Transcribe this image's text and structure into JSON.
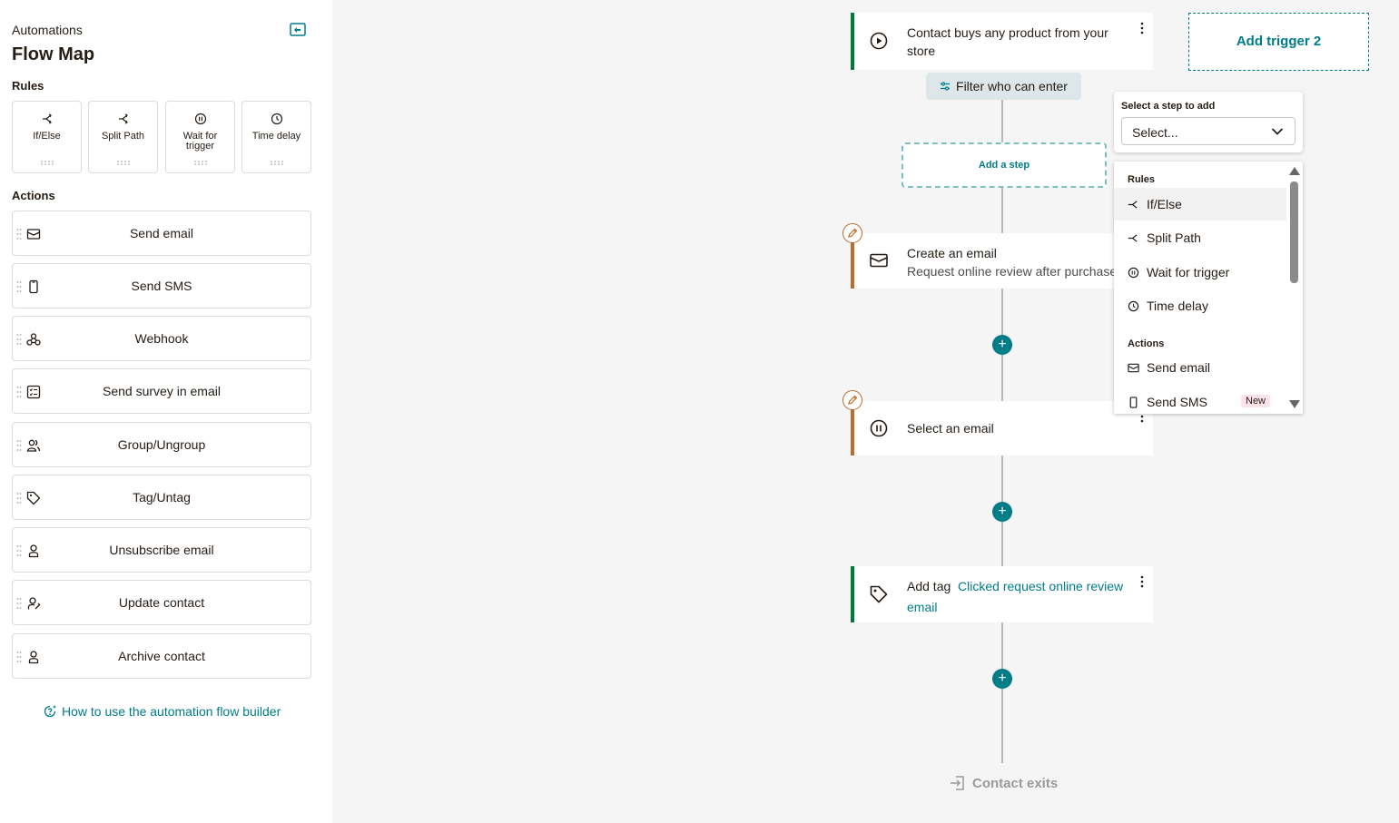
{
  "sidebar": {
    "breadcrumb": "Automations",
    "title": "Flow Map",
    "rules_heading": "Rules",
    "actions_heading": "Actions",
    "rules": [
      {
        "label": "If/Else",
        "icon": "split-icon"
      },
      {
        "label": "Split Path",
        "icon": "split-icon"
      },
      {
        "label": "Wait for trigger",
        "icon": "pause-circle-icon"
      },
      {
        "label": "Time delay",
        "icon": "clock-icon"
      }
    ],
    "actions": [
      {
        "label": "Send email",
        "icon": "envelope-icon"
      },
      {
        "label": "Send SMS",
        "icon": "phone-icon"
      },
      {
        "label": "Webhook",
        "icon": "webhook-icon"
      },
      {
        "label": "Send survey in email",
        "icon": "survey-icon"
      },
      {
        "label": "Group/Ungroup",
        "icon": "group-icon"
      },
      {
        "label": "Tag/Untag",
        "icon": "tag-icon"
      },
      {
        "label": "Unsubscribe email",
        "icon": "person-icon"
      },
      {
        "label": "Update contact",
        "icon": "person-edit-icon"
      },
      {
        "label": "Archive contact",
        "icon": "person-icon"
      }
    ],
    "help_link": "How to use the automation flow builder"
  },
  "flow": {
    "trigger": {
      "text": "Contact buys any product from your store"
    },
    "add_trigger": "Add trigger 2",
    "filter": "Filter who can enter",
    "add_step": "Add a step",
    "step1": {
      "title": "Create an email",
      "subtitle": "Request online review after purchase"
    },
    "step2": {
      "title": "Select an email"
    },
    "step3": {
      "prefix": "Add tag",
      "tag": "Clicked request online review email"
    },
    "exit": "Contact exits"
  },
  "popup": {
    "label": "Select a step to add",
    "placeholder": "Select...",
    "groups": [
      {
        "name": "Rules",
        "items": [
          "If/Else",
          "Split Path",
          "Wait for trigger",
          "Time delay"
        ]
      },
      {
        "name": "Actions",
        "items": [
          "Send email",
          "Send SMS"
        ]
      }
    ],
    "new_badge": "New"
  },
  "colors": {
    "teal": "#007c89",
    "green": "#007a3d",
    "orange": "#bd6b2d"
  }
}
